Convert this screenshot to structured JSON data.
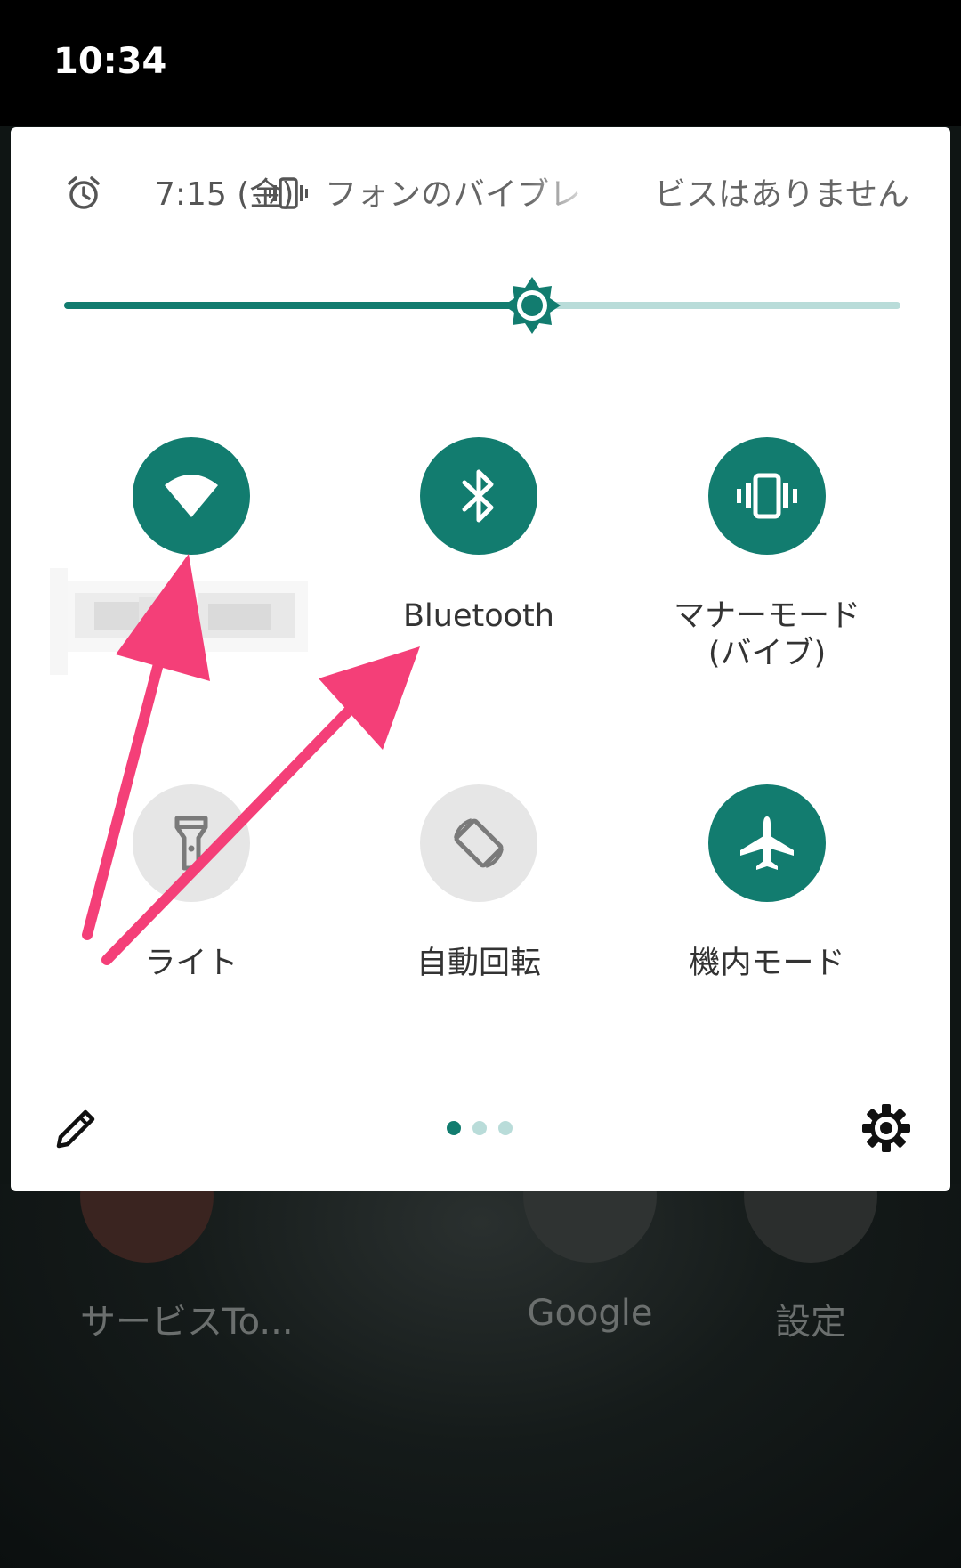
{
  "status_bar": {
    "time": "10:34"
  },
  "header": {
    "alarm_text": "7:15 (金)",
    "vibrate_text": "フォンのバイブレ",
    "dnd_text": "ビスはありません"
  },
  "brightness": {
    "level": 0.56
  },
  "tiles": [
    {
      "label": "",
      "state": "on",
      "icon": "wifi-icon"
    },
    {
      "label": "Bluetooth",
      "state": "on",
      "icon": "bluetooth-icon"
    },
    {
      "label": "マナーモード\n(バイブ)",
      "state": "on",
      "icon": "vibrate-icon"
    },
    {
      "label": "ライト",
      "state": "off",
      "icon": "flashlight-icon"
    },
    {
      "label": "自動回転",
      "state": "off",
      "icon": "auto-rotate-icon"
    },
    {
      "label": "機内モード",
      "state": "on",
      "icon": "airplane-icon"
    }
  ],
  "pager": {
    "total": 3,
    "active": 0
  },
  "home_apps": [
    {
      "label": "サービスTo...",
      "icon": "au-icon"
    },
    {
      "label": "Google",
      "icon": "google-folder-icon"
    },
    {
      "label": "設定",
      "icon": "settings-app-icon"
    }
  ],
  "colors": {
    "accent": "#127c6f",
    "accent_light": "#b9dcd9",
    "tile_off": "#e6e6e6",
    "annotation_arrow": "#f43f78"
  }
}
